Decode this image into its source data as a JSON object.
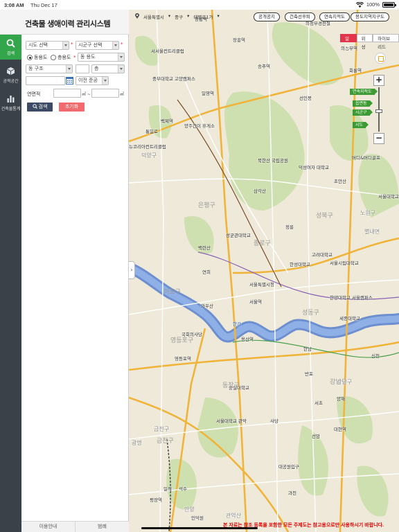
{
  "status": {
    "time": "3:08 AM",
    "date": "Thu Dec 17",
    "battery": "100%"
  },
  "app": {
    "title": "건축물 생애이력 관리시스템"
  },
  "nav": [
    {
      "label": "검색",
      "icon": "search-icon"
    },
    {
      "label": "공적공간",
      "icon": "cube-icon"
    },
    {
      "label": "건축물통계",
      "icon": "bar-chart-icon"
    }
  ],
  "search": {
    "sido": "시도 선택",
    "sigungu": "시군구 선택",
    "radio_dong": "동용도",
    "radio_cheung": "층용도",
    "dong_use": "동 용도",
    "dong_structure": "동 구조",
    "floor_unit": "층",
    "condition": "이전 준공",
    "area_label": "연면적",
    "area_unit_from": "㎡ ~",
    "area_unit_to": "㎡",
    "search_button": "검색",
    "reset_button": "초기화"
  },
  "footer": {
    "guide": "이용안내",
    "legend": "범례"
  },
  "map": {
    "location": {
      "sido": "서울특별시",
      "sigungu": "중구",
      "road": "태평로1가"
    },
    "top_buttons": [
      "공개공지",
      "건축선후퇴",
      "연속지적도",
      "용도지역지구도"
    ],
    "map_types": [
      "일반",
      "위성",
      "하ybrid"
    ],
    "zoom_levels": [
      "연속지적도",
      "읍면동",
      "시군구",
      "시도"
    ],
    "notice": "본 자료는 참조 등록을 포함한 모든 주제도는 참고용으로만 사용하시기 바랍니다.",
    "labels": [
      "서서울컨트리클럽",
      "창릉역",
      "송추역",
      "의정부경전철",
      "의정부역",
      "중부대학교 고양캠퍼스",
      "일영역",
      "선인봉",
      "장흥역",
      "회룡역",
      "백제역",
      "통일로",
      "양주간이 휴게소",
      "뉴코리아컨트리클럽",
      "덕양구",
      "북한산 국립공원",
      "덕성여자 대학교",
      "버디&버디골프",
      "삼각산",
      "초안산",
      "서울대학교 의정부병원",
      "별내면",
      "정릉",
      "성균관대학교",
      "고려대학교",
      "노원구",
      "백련산",
      "한성대학교",
      "서울특별시청",
      "서울시립대학교",
      "한양대학교 서울캠퍼스",
      "서울역",
      "와우산",
      "연희",
      "국회의사당",
      "용산역",
      "영등포역",
      "한강",
      "한남",
      "세종대학교",
      "신천",
      "숭실대학교",
      "반포",
      "서초",
      "서울대학교 관악",
      "사당",
      "과천",
      "선암",
      "대공원입구",
      "대현역",
      "일직",
      "석수",
      "평장역",
      "광명",
      "안양",
      "인덕원",
      "양재",
      "관악산",
      "금천구",
      "강남구"
    ]
  }
}
